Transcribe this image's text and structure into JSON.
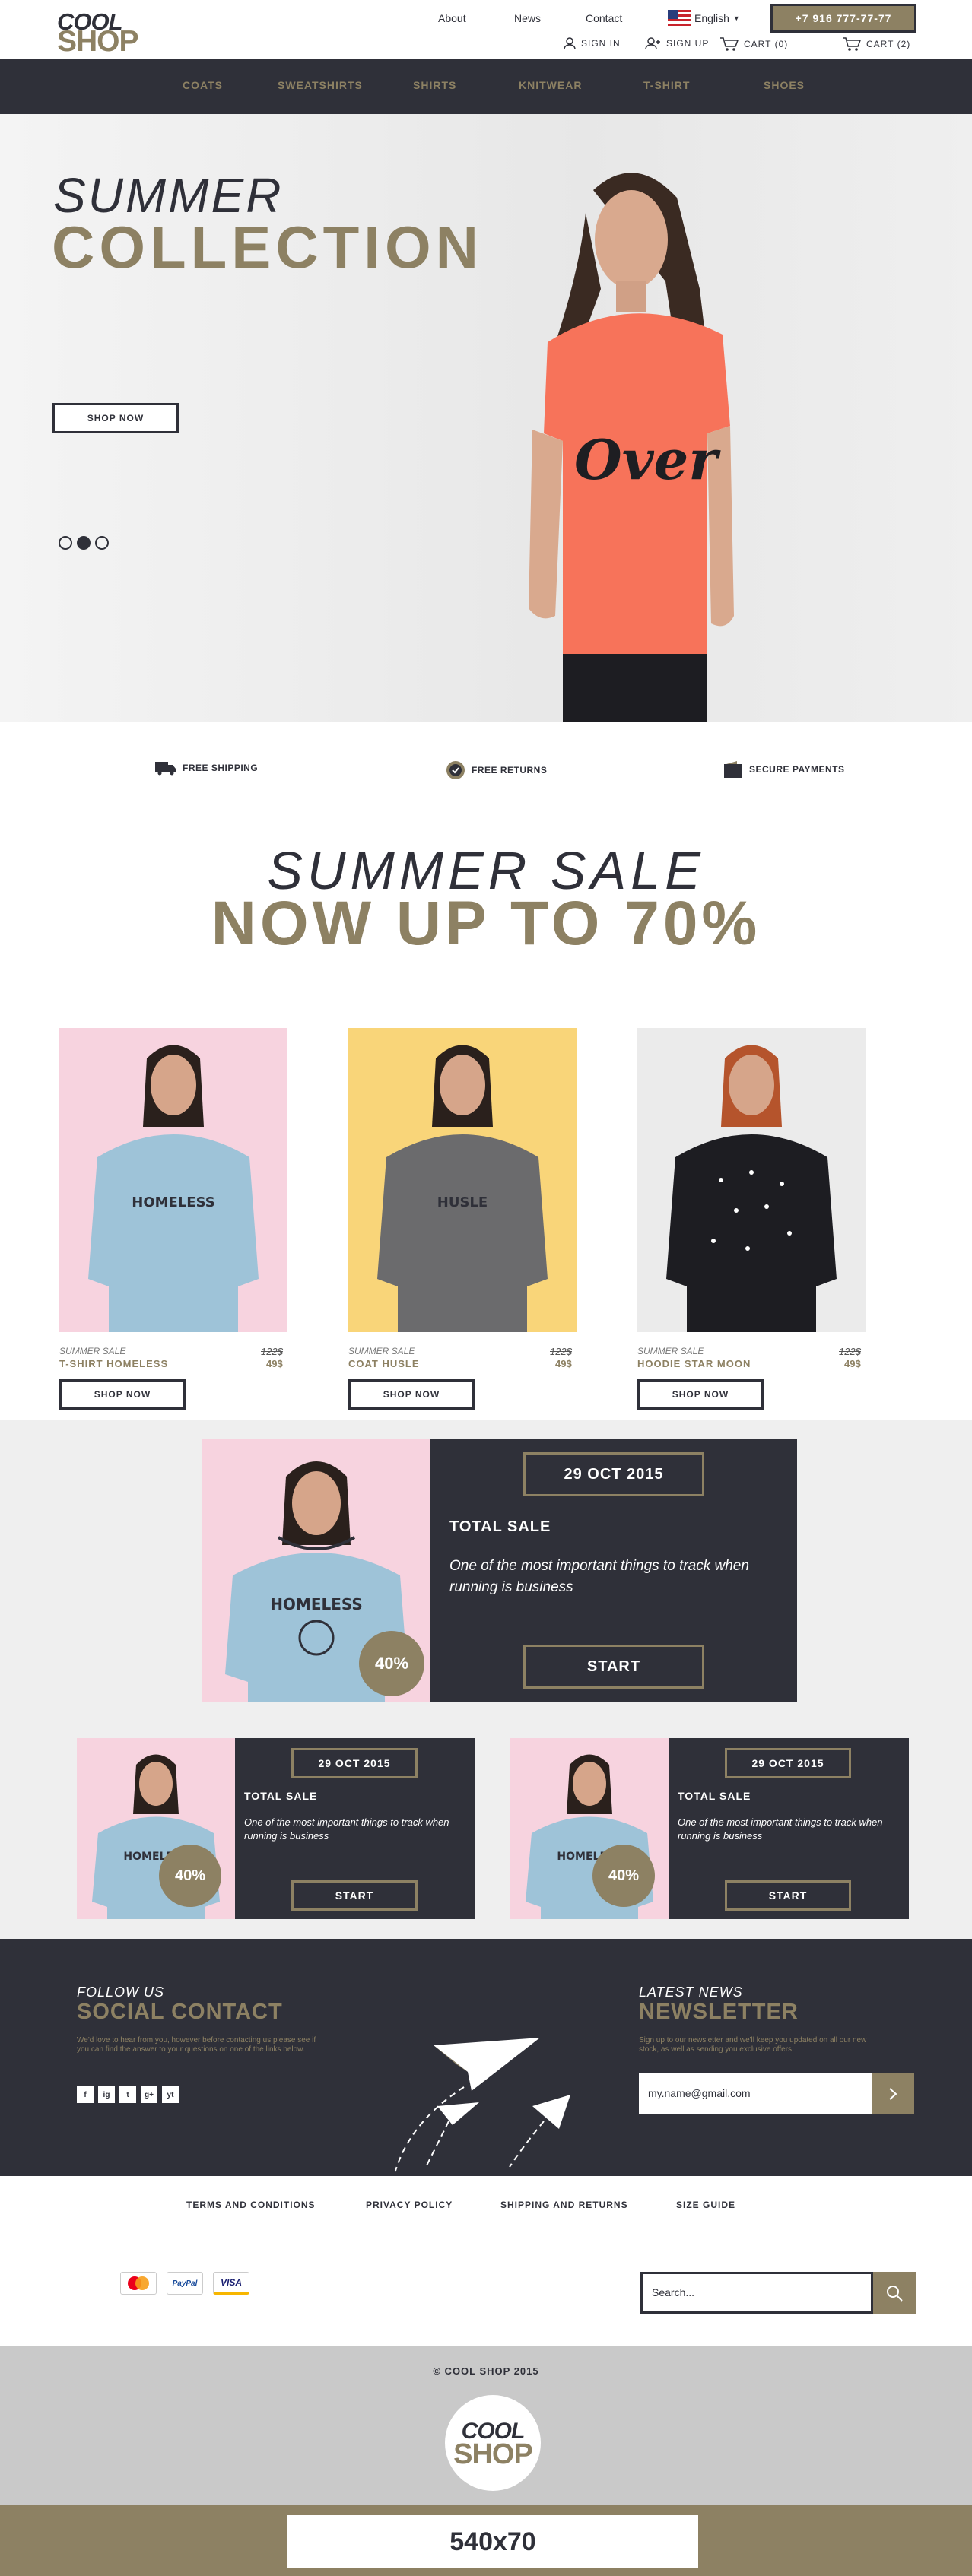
{
  "header": {
    "logo_line1": "COOL",
    "logo_line2": "SHOP",
    "nav": [
      "About",
      "News",
      "Contact"
    ],
    "language": "English",
    "phone": "+7 916 777-77-77",
    "sign_in": "SIGN IN",
    "sign_up": "SIGN UP",
    "cart1": "CART (0)",
    "cart2": "CART (2)"
  },
  "categories": [
    "COATS",
    "SWEATSHIRTS",
    "SHIRTS",
    "KNITWEAR",
    "T-SHIRT",
    "SHOES"
  ],
  "hero": {
    "line1": "SUMMER",
    "line2": "COLLECTION",
    "button": "SHOP NOW",
    "shirt_text": "Over"
  },
  "features": [
    "FREE SHIPPING",
    "FREE RETURNS",
    "SECURE PAYMENTS"
  ],
  "sale": {
    "line1": "SUMMER SALE",
    "line2": "NOW UP TO 70%"
  },
  "products": [
    {
      "label": "SUMMER SALE",
      "name": "T-SHIRT HOMELESS",
      "old_price": "122$",
      "price": "49$",
      "button": "SHOP NOW",
      "bg": "#f7d3df",
      "print": "HOMELESS"
    },
    {
      "label": "SUMMER SALE",
      "name": "COAT HUSLE",
      "old_price": "122$",
      "price": "49$",
      "button": "SHOP NOW",
      "bg": "#f9d579",
      "print": "HUSLE"
    },
    {
      "label": "SUMMER SALE",
      "name": "HOODIE STAR MOON",
      "old_price": "122$",
      "price": "49$",
      "button": "SHOP NOW",
      "bg": "#ebebeb",
      "print": ""
    }
  ],
  "promo_big": {
    "date": "29 OCT 2015",
    "title": "TOTAL SALE",
    "text": "One of the most important things to track when running is business",
    "button": "START",
    "badge": "40%"
  },
  "promo_small": [
    {
      "date": "29 OCT 2015",
      "title": "TOTAL SALE",
      "text": "One of the most important things to track when running is business",
      "button": "START",
      "badge": "40%"
    },
    {
      "date": "29 OCT 2015",
      "title": "TOTAL SALE",
      "text": "One of the most important things to track when running is business",
      "button": "START",
      "badge": "40%"
    }
  ],
  "footer": {
    "follow_small": "FOLLOW US",
    "follow_big": "SOCIAL CONTACT",
    "follow_text": "We'd love to hear from you, however before contacting us please see if you can find the answer to your questions on one of the links below.",
    "news_small": "LATEST NEWS",
    "news_big": "NEWSLETTER",
    "news_text": "Sign up to our newsletter and we'll keep you updated on all our new stock, as well as sending you exclusive offers",
    "email_value": "my.name@gmail.com",
    "social": [
      "f",
      "ig",
      "t",
      "g+",
      "yt"
    ],
    "links": [
      "TERMS AND CONDITIONS",
      "PRIVACY POLICY",
      "SHIPPING AND RETURNS",
      "SIZE GUIDE"
    ],
    "payments": [
      "MasterCard",
      "PayPal",
      "VISA"
    ],
    "search_placeholder": "Search...",
    "copyright": "© COOL SHOP 2015",
    "banner": "540x70"
  },
  "colors": {
    "accent": "#8d8163",
    "dark": "#2f3039"
  }
}
